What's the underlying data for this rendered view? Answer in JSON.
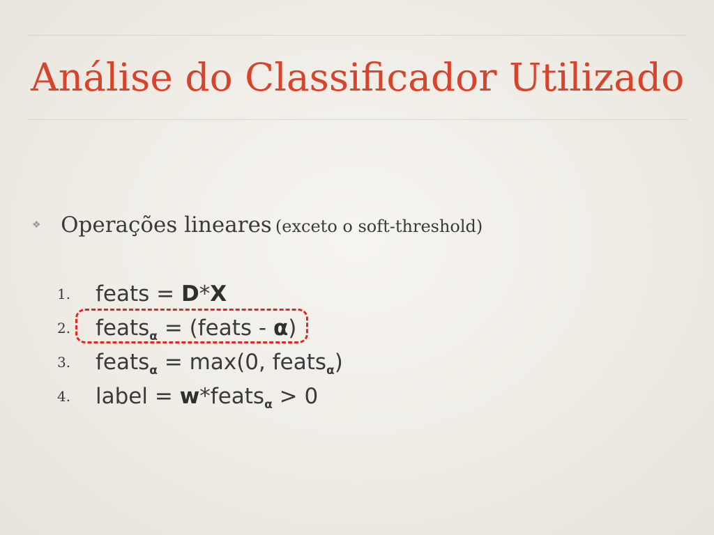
{
  "slide": {
    "title": "Análise do Classificador Utilizado",
    "bullet": {
      "icon": "diamond-flower-bullet-icon",
      "text": "Operações lineares",
      "note": "(exceto o soft-threshold)"
    },
    "steps": [
      {
        "number": "1.",
        "p1": "feats = ",
        "b1": "D",
        "p2": "*",
        "b2": "X"
      },
      {
        "number": "2.",
        "p1": "feats",
        "s1": "α",
        "p2": " = (feats - ",
        "b1": "α",
        "p3": ")"
      },
      {
        "number": "3.",
        "p1": "feats",
        "s1": "α",
        "p2": " = max(0, feats",
        "s2": "α",
        "p3": ")"
      },
      {
        "number": "4.",
        "p1": "label = ",
        "b1": "w",
        "p2": "*feats",
        "s1": "α",
        "p3": " > 0"
      }
    ],
    "highlight_color": "#e0281e",
    "title_color": "#d8432c"
  }
}
